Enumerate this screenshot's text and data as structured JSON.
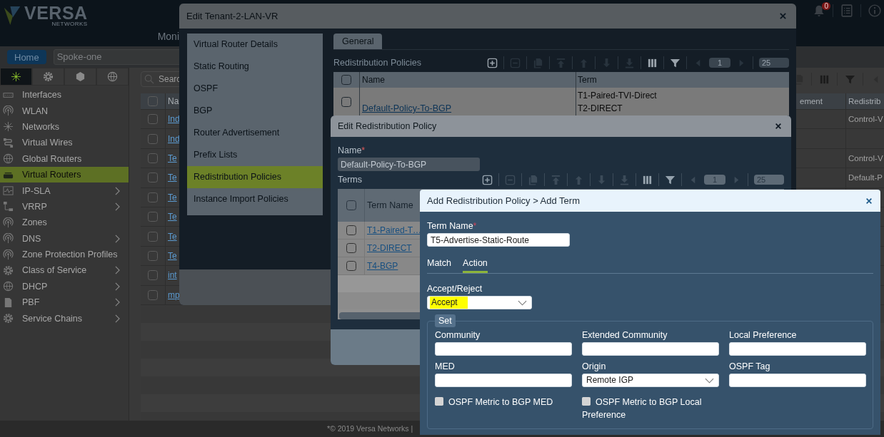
{
  "header": {
    "logo": "VERSA",
    "logo_sub": "NETWORKS",
    "nav_fragment": "Moni",
    "notification_count": "0"
  },
  "breadcrumb": {
    "home": "Home",
    "device": "Spoke-one"
  },
  "sidebar": {
    "tabs": [
      {
        "selected": true
      },
      {
        "selected": false
      },
      {
        "selected": false
      },
      {
        "selected": false
      }
    ],
    "items": [
      {
        "label": "Interfaces",
        "selected": false,
        "expandable": false
      },
      {
        "label": "WLAN",
        "selected": false,
        "expandable": false
      },
      {
        "label": "Networks",
        "selected": false,
        "expandable": false
      },
      {
        "label": "Virtual Wires",
        "selected": false,
        "expandable": false
      },
      {
        "label": "Global Routers",
        "selected": false,
        "expandable": false
      },
      {
        "label": "Virtual Routers",
        "selected": true,
        "expandable": false
      },
      {
        "label": "IP-SLA",
        "selected": false,
        "expandable": true
      },
      {
        "label": "VRRP",
        "selected": false,
        "expandable": true
      },
      {
        "label": "Zones",
        "selected": false,
        "expandable": false
      },
      {
        "label": "DNS",
        "selected": false,
        "expandable": true
      },
      {
        "label": "Zone Protection Profiles",
        "selected": false,
        "expandable": false
      },
      {
        "label": "Class of Service",
        "selected": false,
        "expandable": true
      },
      {
        "label": "DHCP",
        "selected": false,
        "expandable": true
      },
      {
        "label": "PBF",
        "selected": false,
        "expandable": true
      },
      {
        "label": "Service Chains",
        "selected": false,
        "expandable": true
      }
    ]
  },
  "background_table": {
    "search_placeholder": "Searc",
    "toolbar": {
      "buttons": [
        {
          "kind": "copy",
          "disabled": true
        },
        {
          "kind": "columns",
          "disabled": false
        },
        {
          "kind": "filter",
          "disabled": false
        },
        {
          "kind": "prev",
          "disabled": true
        }
      ]
    },
    "columns": [
      "Na",
      "ement",
      "Redistrib"
    ],
    "header_checked": false,
    "rows": [
      {
        "name": "Ind",
        "checked": false,
        "redistribution": "Control-V"
      },
      {
        "name": "Ind",
        "checked": false
      },
      {
        "name": "Te",
        "checked": false,
        "redistribution": "Control-V"
      },
      {
        "name": "Te",
        "checked": false,
        "redistribution": "Default-P"
      },
      {
        "name": "Te",
        "checked": false
      },
      {
        "name": "Te",
        "checked": false
      },
      {
        "name": "Te",
        "checked": false
      },
      {
        "name": "Te",
        "checked": false
      },
      {
        "name": "int",
        "checked": false
      },
      {
        "name": "mp",
        "checked": false
      }
    ]
  },
  "footer": {
    "copyright": "*© 2019 Versa Networks |"
  },
  "dialog": {
    "title": "Edit Tenant-2-LAN-VR",
    "nav": [
      {
        "label": "Virtual Router Details",
        "selected": false
      },
      {
        "label": "Static Routing",
        "selected": false
      },
      {
        "label": "OSPF",
        "selected": false
      },
      {
        "label": "BGP",
        "selected": false
      },
      {
        "label": "Router Advertisement",
        "selected": false
      },
      {
        "label": "Prefix Lists",
        "selected": false
      },
      {
        "label": "Redistribution Policies",
        "selected": true
      },
      {
        "label": "Instance Import Policies",
        "selected": false
      }
    ],
    "tabs": [
      {
        "label": "General",
        "selected": true
      }
    ],
    "section": "Redistribution Policies",
    "toolbar": {
      "buttons": [
        {
          "kind": "add",
          "disabled": false
        },
        {
          "kind": "remove",
          "disabled": true
        },
        {
          "kind": "copy",
          "disabled": true
        },
        {
          "kind": "top",
          "disabled": true
        },
        {
          "kind": "up",
          "disabled": true
        },
        {
          "kind": "down",
          "disabled": true
        },
        {
          "kind": "bottom",
          "disabled": true
        },
        {
          "kind": "columns",
          "disabled": false
        },
        {
          "kind": "filter",
          "disabled": false
        },
        {
          "kind": "prev",
          "disabled": true
        },
        {
          "kind": "next",
          "disabled": true
        }
      ],
      "page": "1",
      "page_size": "25"
    },
    "columns": [
      "Name",
      "Term"
    ],
    "header_checked": false,
    "rows": [
      {
        "name": "Default-Policy-To-BGP",
        "checked": false,
        "terms": [
          "T1-Paired-TVI-Direct",
          "T2-DIRECT"
        ]
      }
    ]
  },
  "policy_dialog": {
    "title": "Edit Redistribution Policy",
    "name": {
      "label": "Name",
      "required_mark": "*",
      "value": "Default-Policy-To-BGP"
    },
    "terms_label": "Terms",
    "toolbar": {
      "buttons": [
        {
          "kind": "add",
          "disabled": false
        },
        {
          "kind": "remove",
          "disabled": true
        },
        {
          "kind": "copy",
          "disabled": true
        },
        {
          "kind": "top",
          "disabled": true
        },
        {
          "kind": "up",
          "disabled": true
        },
        {
          "kind": "down",
          "disabled": true
        },
        {
          "kind": "bottom",
          "disabled": true
        },
        {
          "kind": "columns",
          "disabled": false
        },
        {
          "kind": "filter",
          "disabled": false
        },
        {
          "kind": "prev",
          "disabled": true
        },
        {
          "kind": "next",
          "disabled": true
        }
      ],
      "page": "1",
      "page_size": "25"
    },
    "columns": [
      "Term Name"
    ],
    "header_checked": false,
    "rows": [
      {
        "name": "T1-Paired-T…",
        "checked": false
      },
      {
        "name": "T2-DIRECT",
        "checked": false
      },
      {
        "name": "T4-BGP",
        "checked": false
      }
    ]
  },
  "term_dialog": {
    "title": "Add Redistribution Policy > Add Term",
    "term_name": {
      "label": "Term Name",
      "required_mark": "*",
      "value": "T5-Advertise-Static-Route"
    },
    "tabs": [
      {
        "label": "Match",
        "selected": false
      },
      {
        "label": "Action",
        "selected": true
      }
    ],
    "accept_reject": {
      "label": "Accept/Reject",
      "value": "Accept",
      "highlighted": true
    },
    "set": {
      "legend": "Set",
      "fields": [
        {
          "label": "Community",
          "kind": "input"
        },
        {
          "label": "Extended Community",
          "kind": "input"
        },
        {
          "label": "Local Preference",
          "kind": "input"
        },
        {
          "label": "MED",
          "kind": "input"
        },
        {
          "label": "Origin",
          "kind": "select",
          "value": "Remote IGP"
        },
        {
          "label": "OSPF Tag",
          "kind": "input"
        }
      ],
      "checkboxes": [
        {
          "label": "OSPF Metric to BGP MED",
          "checked": false
        },
        {
          "label": "OSPF Metric to BGP Local Preference",
          "checked": false
        }
      ]
    }
  }
}
